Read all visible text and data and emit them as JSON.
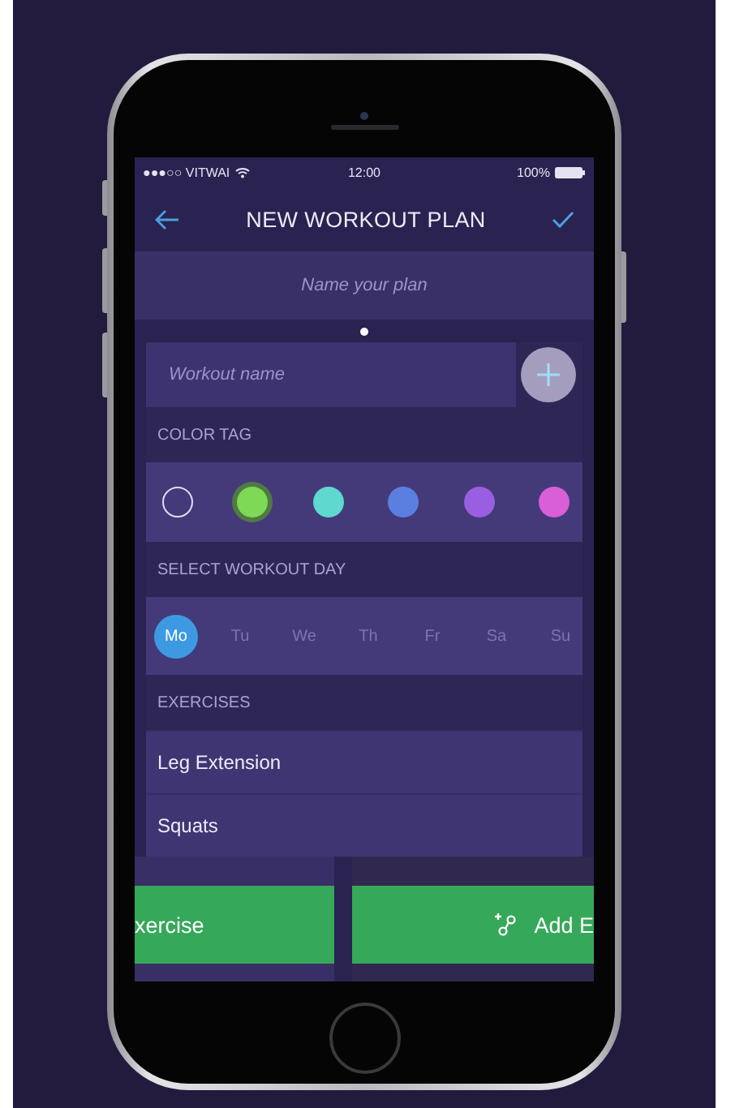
{
  "status_bar": {
    "carrier": "●●●○○ VITWAI",
    "time": "12:00",
    "battery": "100%"
  },
  "nav": {
    "title": "NEW WORKOUT PLAN"
  },
  "plan_name": {
    "placeholder": "Name your plan"
  },
  "workout_name": {
    "placeholder": "Workout name"
  },
  "color_tag": {
    "label": "COLOR TAG",
    "options": [
      {
        "kind": "none",
        "selected": false
      },
      {
        "kind": "swatch",
        "color": "#7ed957",
        "selected": true
      },
      {
        "kind": "swatch",
        "color": "#5fd8cf",
        "selected": false
      },
      {
        "kind": "swatch",
        "color": "#5b7fe0",
        "selected": false
      },
      {
        "kind": "swatch",
        "color": "#9a5fe0",
        "selected": false
      },
      {
        "kind": "swatch",
        "color": "#d95fd9",
        "selected": false
      }
    ]
  },
  "workout_day": {
    "label": "SELECT WORKOUT DAY",
    "days": [
      {
        "label": "Mo",
        "selected": true
      },
      {
        "label": "Tu",
        "selected": false
      },
      {
        "label": "We",
        "selected": false
      },
      {
        "label": "Th",
        "selected": false
      },
      {
        "label": "Fr",
        "selected": false
      },
      {
        "label": "Sa",
        "selected": false
      },
      {
        "label": "Su",
        "selected": false
      }
    ]
  },
  "exercises": {
    "label": "EXERCISES",
    "items": [
      "Leg Extension",
      "Squats"
    ]
  },
  "buttons": [
    {
      "label": "xercise",
      "kind": "plain"
    },
    {
      "label": "Add E",
      "kind": "add"
    }
  ]
}
